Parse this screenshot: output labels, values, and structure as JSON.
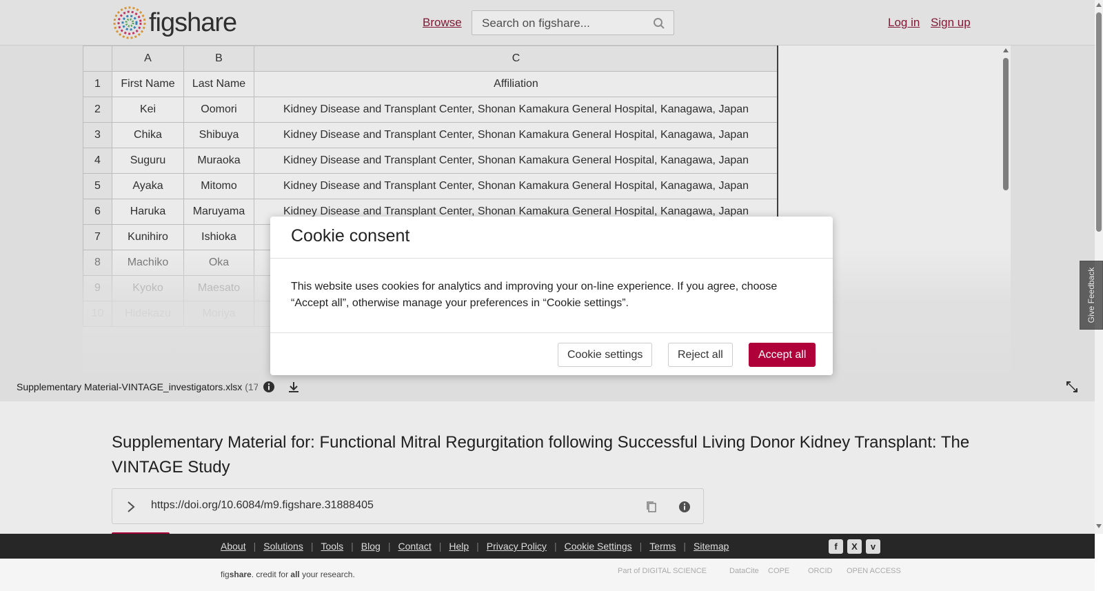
{
  "header": {
    "logo_text": "figshare",
    "browse_label": "Browse",
    "search_placeholder": "Search on figshare...",
    "login_label": "Log in",
    "signup_label": "Sign up"
  },
  "spreadsheet": {
    "columns": [
      "A",
      "B",
      "C"
    ],
    "rows": [
      {
        "num": "1",
        "a": "First Name",
        "b": "Last Name",
        "c": "Affiliation"
      },
      {
        "num": "2",
        "a": "Kei",
        "b": "Oomori",
        "c": "Kidney Disease and Transplant Center, Shonan Kamakura General Hospital, Kanagawa, Japan"
      },
      {
        "num": "3",
        "a": "Chika",
        "b": "Shibuya",
        "c": "Kidney Disease and Transplant Center, Shonan Kamakura General Hospital, Kanagawa, Japan"
      },
      {
        "num": "4",
        "a": "Suguru",
        "b": "Muraoka",
        "c": "Kidney Disease and Transplant Center, Shonan Kamakura General Hospital, Kanagawa, Japan"
      },
      {
        "num": "5",
        "a": "Ayaka",
        "b": "Mitomo",
        "c": "Kidney Disease and Transplant Center, Shonan Kamakura General Hospital, Kanagawa, Japan"
      },
      {
        "num": "6",
        "a": "Haruka",
        "b": "Maruyama",
        "c": "Kidney Disease and Transplant Center, Shonan Kamakura General Hospital, Kanagawa, Japan"
      },
      {
        "num": "7",
        "a": "Kunihiro",
        "b": "Ishioka",
        "c": ""
      },
      {
        "num": "8",
        "a": "Machiko",
        "b": "Oka",
        "c": ""
      },
      {
        "num": "9",
        "a": "Kyoko",
        "b": "Maesato",
        "c": ""
      },
      {
        "num": "10",
        "a": "Hidekazu",
        "b": "Moriya",
        "c": ""
      }
    ]
  },
  "file": {
    "name": "Supplementary Material-VINTAGE_investigators.xlsx",
    "size_fragment": "(17"
  },
  "article": {
    "title": "Supplementary Material for: Functional Mitral Regurgitation following Successful Living Donor Kidney Transplant: The VINTAGE Study",
    "doi": "https://doi.org/10.6084/m9.figshare.31888405"
  },
  "feedback_label": "Give Feedback",
  "cookie": {
    "title": "Cookie consent",
    "body": "This website uses cookies for analytics and improving your on-line experience. If you agree, choose “Accept all”, otherwise manage your preferences in “Cookie settings”.",
    "settings_label": "Cookie settings",
    "reject_label": "Reject all",
    "accept_label": "Accept all"
  },
  "footer": {
    "links": [
      "About",
      "Solutions",
      "Tools",
      "Blog",
      "Contact",
      "Help",
      "Privacy Policy",
      "Cookie Settings",
      "Terms",
      "Sitemap"
    ],
    "tagline_pre": "fig",
    "tagline_brand": "share",
    "tagline_mid": ". credit for ",
    "tagline_bold": "all",
    "tagline_post": " your research.",
    "social_icons": [
      "facebook-icon",
      "x-icon",
      "vimeo-icon"
    ],
    "partners": [
      "Part of DIGITAL SCIENCE",
      "DataCite",
      "COPE",
      "ORCID",
      "OPEN ACCESS"
    ]
  },
  "colors": {
    "brand": "#b0003a",
    "link": "#8c1b3a",
    "footer_bg": "#272727"
  }
}
